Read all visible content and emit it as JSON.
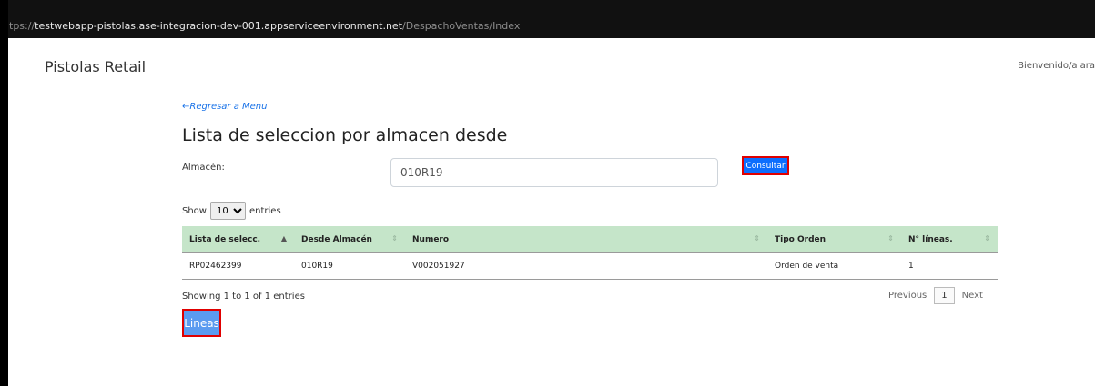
{
  "browser": {
    "url_prefix": "tps://",
    "url_host": "testwebapp-pistolas.ase-integracion-dev-001.appserviceenvironment.net",
    "url_path": "/DespachoVentas/Index"
  },
  "navbar": {
    "brand": "Pistolas Retail",
    "welcome": "Bienvenido/a ara"
  },
  "page": {
    "back_link": "←Regresar a Menu",
    "title": "Lista de seleccion por almacen desde",
    "warehouse_label": "Almacén:",
    "warehouse_value": "010R19",
    "consultar_label": "Consultar"
  },
  "length_control": {
    "show_label": "Show",
    "selected": "10",
    "entries_label": "entries"
  },
  "table": {
    "columns": [
      "Lista de selecc.",
      "Desde Almacén",
      "Numero",
      "Tipo Orden",
      "N° líneas."
    ],
    "rows": [
      [
        "RP02462399",
        "010R19",
        "V002051927",
        "Orden de venta",
        "1"
      ]
    ]
  },
  "footer": {
    "info": "Showing 1 to 1 of 1 entries",
    "previous": "Previous",
    "current_page": "1",
    "next": "Next"
  },
  "lineas_label": "Lineas"
}
